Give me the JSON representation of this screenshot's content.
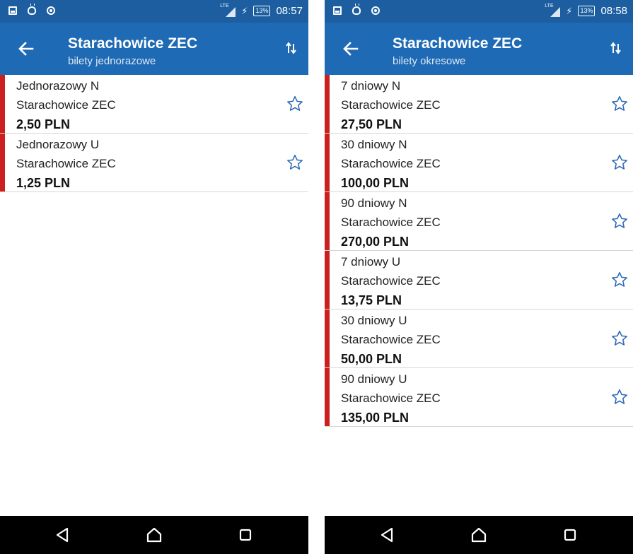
{
  "left_screen": {
    "status_bar": {
      "network": "LTE",
      "battery": "13%",
      "time": "08:57"
    },
    "app_bar": {
      "title": "Starachowice ZEC",
      "subtitle": "bilety jednorazowe"
    },
    "tickets": [
      {
        "name": "Jednorazowy N",
        "zone": "Starachowice ZEC",
        "price": "2,50 PLN"
      },
      {
        "name": "Jednorazowy U",
        "zone": "Starachowice ZEC",
        "price": "1,25 PLN"
      }
    ]
  },
  "right_screen": {
    "status_bar": {
      "network": "LTE",
      "battery": "13%",
      "time": "08:58"
    },
    "app_bar": {
      "title": "Starachowice ZEC",
      "subtitle": "bilety okresowe"
    },
    "tickets": [
      {
        "name": "7 dniowy N",
        "zone": "Starachowice ZEC",
        "price": "27,50 PLN"
      },
      {
        "name": "30 dniowy N",
        "zone": "Starachowice ZEC",
        "price": "100,00 PLN"
      },
      {
        "name": "90 dniowy N",
        "zone": "Starachowice ZEC",
        "price": "270,00 PLN"
      },
      {
        "name": "7 dniowy U",
        "zone": "Starachowice ZEC",
        "price": "13,75 PLN"
      },
      {
        "name": "30 dniowy U",
        "zone": "Starachowice ZEC",
        "price": "50,00 PLN"
      },
      {
        "name": "90 dniowy U",
        "zone": "Starachowice ZEC",
        "price": "135,00 PLN"
      }
    ]
  },
  "icons": {
    "back": "arrow-left-icon",
    "sort": "sort-arrows-icon",
    "favorite": "star-outline-icon",
    "nav_back": "triangle-back-icon",
    "nav_home": "home-icon",
    "nav_recent": "square-recent-icon"
  },
  "colors": {
    "status_bar": "#1c5ea0",
    "app_bar": "#1f6ab5",
    "accent_bar": "#cc1f1f",
    "star": "#2a67b3",
    "nav_bar": "#000000"
  }
}
